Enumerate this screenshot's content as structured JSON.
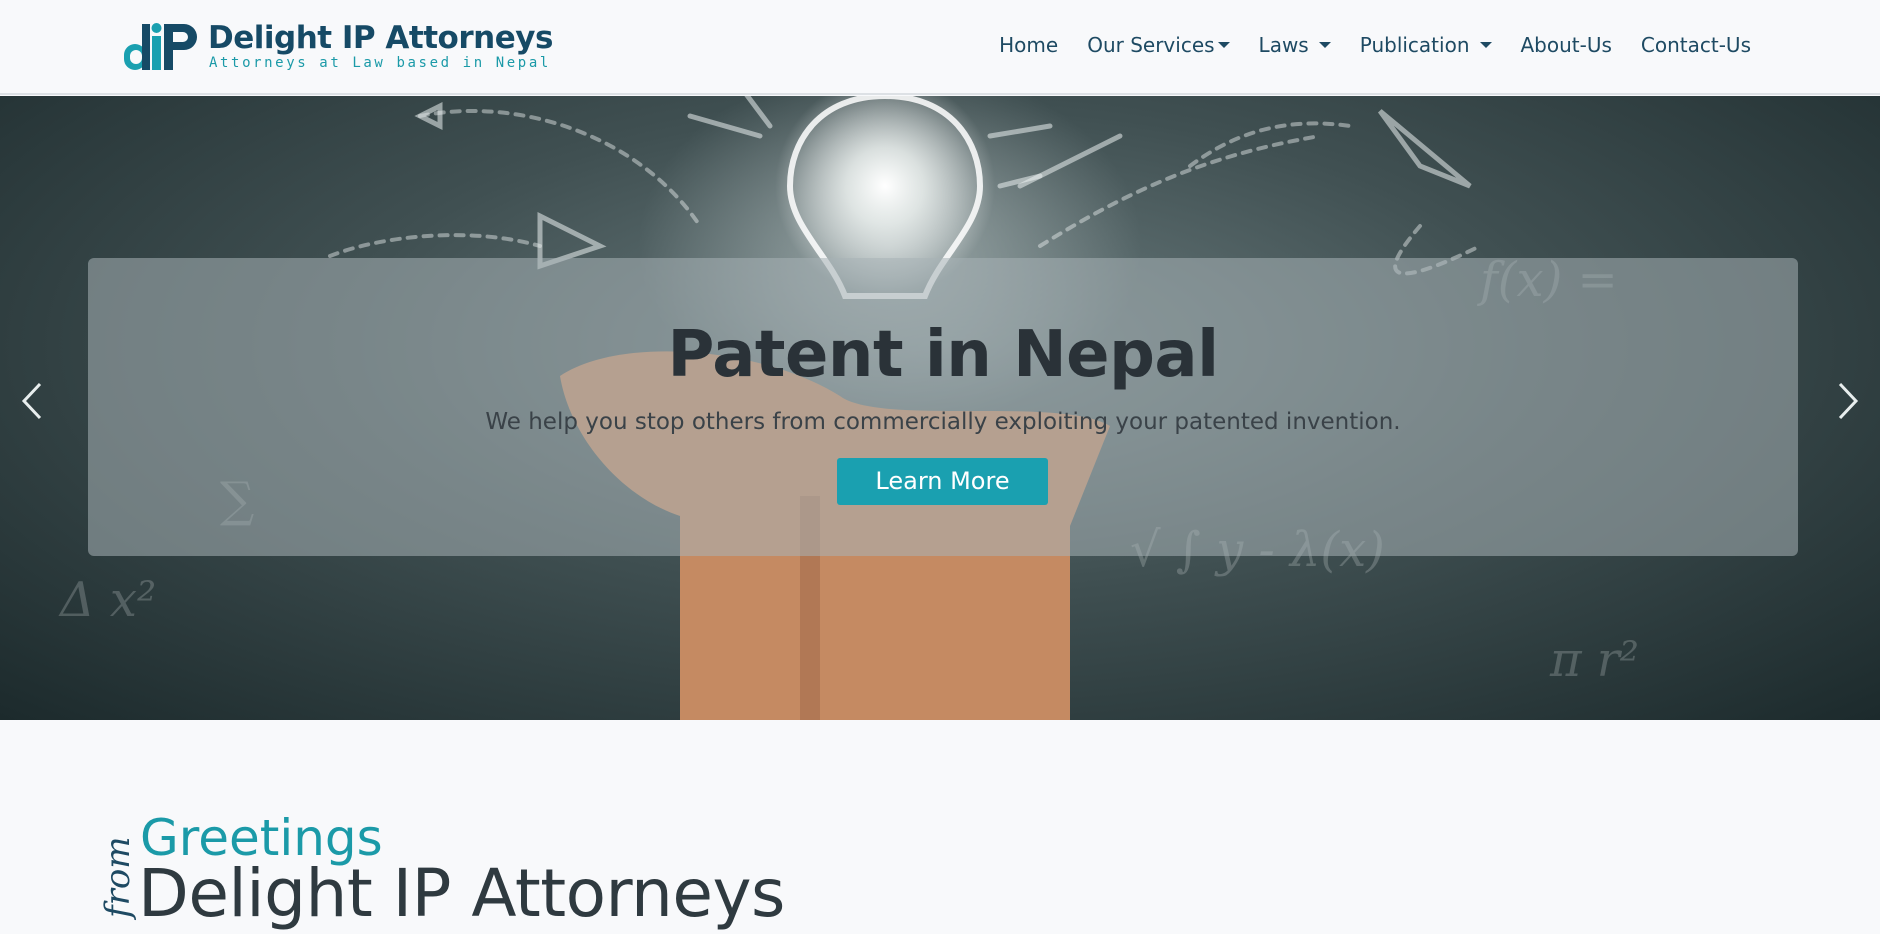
{
  "brand": {
    "logo_text": "dIP",
    "name": "Delight IP Attorneys",
    "tagline": "Attorneys at Law based in Nepal"
  },
  "nav": {
    "items": [
      {
        "label": "Home",
        "dropdown": false
      },
      {
        "label": "Our Services",
        "dropdown": true
      },
      {
        "label": "Laws",
        "dropdown": true
      },
      {
        "label": "Publication",
        "dropdown": true
      },
      {
        "label": "About-Us",
        "dropdown": false
      },
      {
        "label": "Contact-Us",
        "dropdown": false
      }
    ]
  },
  "hero": {
    "title": "Patent in Nepal",
    "subtitle": "We help you stop others from commercially exploiting your patented invention.",
    "button_label": "Learn More",
    "prev_icon": "chevron-left-icon",
    "next_icon": "chevron-right-icon"
  },
  "greeting": {
    "from": "from",
    "line1": "Greetings",
    "line2": "Delight IP Attorneys"
  },
  "colors": {
    "brand_dark": "#164a66",
    "accent": "#1aa0b0",
    "nav_text": "#1e4a63"
  }
}
